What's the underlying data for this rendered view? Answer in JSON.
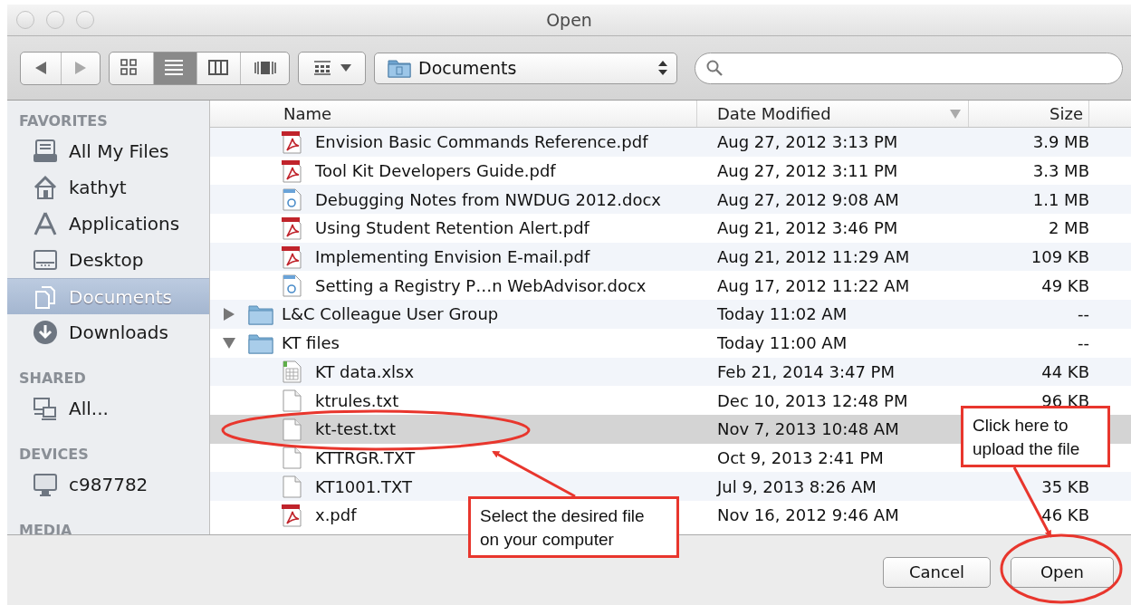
{
  "window": {
    "title": "Open"
  },
  "toolbar": {
    "location": "Documents",
    "view_modes": [
      {
        "kind": "icons",
        "selected": false
      },
      {
        "kind": "list",
        "selected": true
      },
      {
        "kind": "columns",
        "selected": false
      },
      {
        "kind": "coverflow",
        "selected": false
      }
    ]
  },
  "sidebar": {
    "sections": [
      {
        "title": "FAVORITES",
        "items": [
          {
            "label": "All My Files",
            "kind": "files",
            "selected": false
          },
          {
            "label": "kathyt",
            "kind": "home",
            "selected": false
          },
          {
            "label": "Applications",
            "kind": "apps",
            "selected": false
          },
          {
            "label": "Desktop",
            "kind": "desktop",
            "selected": false
          },
          {
            "label": "Documents",
            "kind": "documents",
            "selected": true
          },
          {
            "label": "Downloads",
            "kind": "downloads",
            "selected": false
          }
        ]
      },
      {
        "title": "SHARED",
        "items": [
          {
            "label": "All...",
            "kind": "network",
            "selected": false
          }
        ]
      },
      {
        "title": "DEVICES",
        "items": [
          {
            "label": "c987782",
            "kind": "computer",
            "selected": false
          }
        ]
      },
      {
        "title": "MEDIA"
      }
    ]
  },
  "table": {
    "columns": [
      {
        "label": "Name",
        "sorted": false
      },
      {
        "label": "Date Modified",
        "sorted": true
      },
      {
        "label": "Size",
        "sorted": false
      }
    ],
    "rows": [
      {
        "name": "Envision Basic Commands Reference.pdf",
        "kind": "pdf",
        "date": "Aug 27, 2012 3:13 PM",
        "size": "3.9 MB",
        "selected": false
      },
      {
        "name": "Tool Kit Developers Guide.pdf",
        "kind": "pdf",
        "date": "Aug 27, 2012 3:11 PM",
        "size": "3.3 MB",
        "selected": false
      },
      {
        "name": "Debugging Notes from NWDUG 2012.docx",
        "kind": "doc",
        "date": "Aug 27, 2012 9:08 AM",
        "size": "1.1 MB",
        "selected": false
      },
      {
        "name": "Using Student Retention Alert.pdf",
        "kind": "pdf",
        "date": "Aug 21, 2012 3:46 PM",
        "size": "2 MB",
        "selected": false
      },
      {
        "name": "Implementing Envision E-mail.pdf",
        "kind": "pdf",
        "date": "Aug 21, 2012 11:29 AM",
        "size": "109 KB",
        "selected": false
      },
      {
        "name": "Setting a Registry P…n WebAdvisor.docx",
        "kind": "doc",
        "date": "Aug 17, 2012 11:22 AM",
        "size": "49 KB",
        "selected": false
      },
      {
        "name": "L&C Colleague User Group",
        "kind": "folder",
        "expanded": false,
        "date": "Today 11:02 AM",
        "size": "--",
        "selected": false
      },
      {
        "name": "KT files",
        "kind": "folder",
        "expanded": true,
        "date": "Today 11:00 AM",
        "size": "--",
        "selected": false,
        "children": [
          {
            "name": "KT data.xlsx",
            "kind": "sheet",
            "date": "Feb 21, 2014 3:47 PM",
            "size": "44 KB",
            "selected": false
          },
          {
            "name": "ktrules.txt",
            "kind": "text",
            "date": "Dec 10, 2013 12:48 PM",
            "size": "96 KB",
            "selected": false
          },
          {
            "name": "kt-test.txt",
            "kind": "text",
            "date": "Nov 7, 2013 10:48 AM",
            "selected": true
          },
          {
            "name": "KTTRGR.TXT",
            "kind": "text",
            "date": "Oct 9, 2013 2:41 PM",
            "selected": false
          },
          {
            "name": "KT1001.TXT",
            "kind": "text",
            "date": "Jul 9, 2013 8:26 AM",
            "size": "35 KB",
            "selected": false
          },
          {
            "name": "x.pdf",
            "kind": "pdf",
            "date": "Nov 16, 2012 9:46 AM",
            "size": "46 KB",
            "selected": false
          }
        ]
      }
    ]
  },
  "buttons": [
    {
      "label": "Cancel"
    },
    {
      "label": "Open"
    }
  ],
  "callouts": [
    {
      "text": "Select the desired file\non your computer"
    },
    {
      "text": "Click here to\nupload the file"
    }
  ]
}
